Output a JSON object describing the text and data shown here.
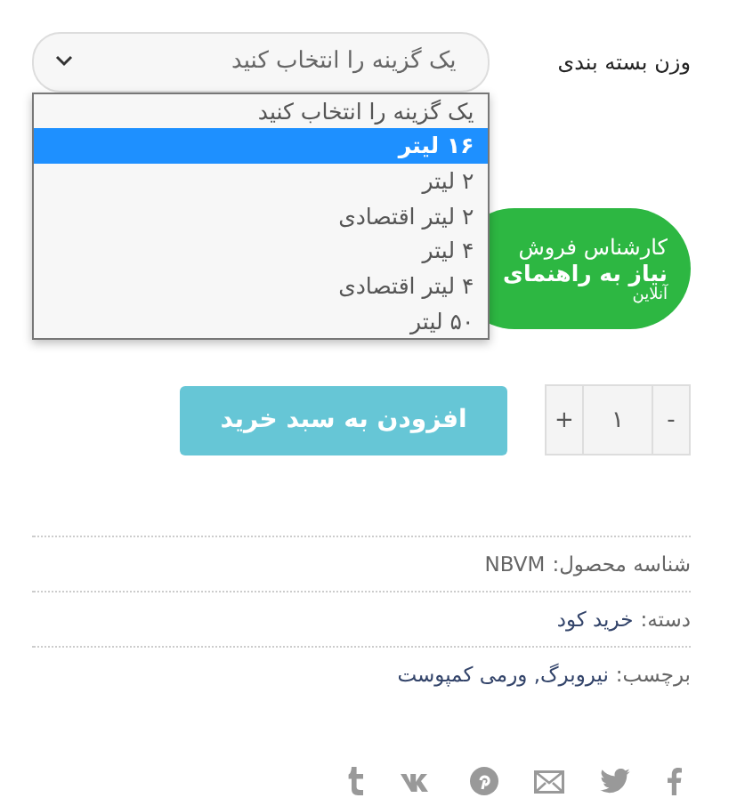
{
  "variation": {
    "label": "وزن بسته بندی",
    "select": {
      "value": "یک گزینه را انتخاب کنید",
      "expanded": true
    },
    "options": [
      {
        "label": "یک گزینه را انتخاب کنید",
        "selected": false
      },
      {
        "label": "۱۶ لیتر",
        "selected": true
      },
      {
        "label": "۲ لیتر",
        "selected": false
      },
      {
        "label": "۲ لیتر اقتصادی",
        "selected": false
      },
      {
        "label": "۴ لیتر",
        "selected": false
      },
      {
        "label": "۴ لیتر اقتصادی",
        "selected": false
      },
      {
        "label": "۵۰ لیتر",
        "selected": false
      }
    ]
  },
  "support_badge": {
    "title": "کارشناس فروش",
    "subtitle": "نیاز به راهنمای",
    "status": "آنلاین"
  },
  "quantity": {
    "minus": "-",
    "value": "۱",
    "plus": "+"
  },
  "add_to_cart": "افزودن به سبد خرید",
  "meta": [
    {
      "label": "شناسه محصول:",
      "value": "NBVM",
      "kind": "text"
    },
    {
      "label": "دسته:",
      "value": "خرید کود",
      "kind": "link"
    },
    {
      "label": "برچسب:",
      "value": "نیروبرگ, ورمی کمپوست",
      "kind": "link"
    }
  ],
  "share": [
    {
      "kind": "facebook"
    },
    {
      "kind": "twitter"
    },
    {
      "kind": "email"
    },
    {
      "kind": "pinterest"
    },
    {
      "kind": "vk"
    },
    {
      "kind": "tumblr"
    }
  ]
}
